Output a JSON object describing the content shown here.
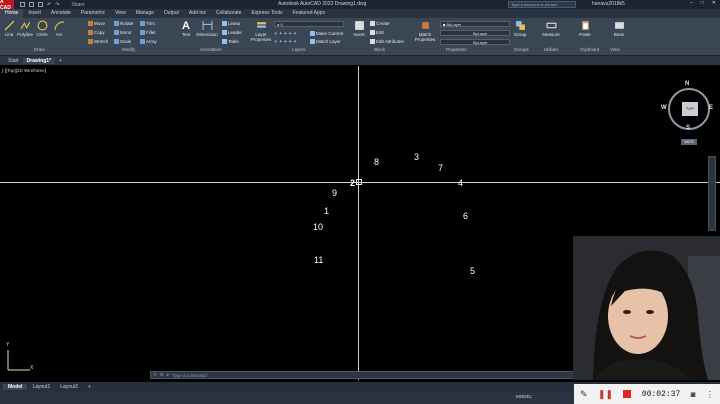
{
  "title_bar": {
    "logo": "A CAD",
    "share": "Share",
    "app_title": "Autodesk AutoCAD 2023   Drawing1.dwg",
    "search_placeholder": "Type a keyword or phrase",
    "user": "honavu2018k5"
  },
  "ribbon_tabs": [
    "Home",
    "Insert",
    "Annotate",
    "Parametric",
    "View",
    "Manage",
    "Output",
    "Add-ins",
    "Collaborate",
    "Express Tools",
    "Featured Apps"
  ],
  "draw": {
    "line": "Line",
    "polyline": "Polyline",
    "circle": "Circle",
    "arc": "Arc",
    "label": "Draw"
  },
  "modify": {
    "move": "Move",
    "rotate": "Rotate",
    "trim": "Trim",
    "copy": "Copy",
    "mirror": "Mirror",
    "fillet": "Fillet",
    "stretch": "Stretch",
    "scale": "Scale",
    "array": "Array",
    "label": "Modify"
  },
  "annotation": {
    "text": "Text",
    "dimension": "Dimension",
    "linear": "Linear",
    "leader": "Leader",
    "table": "Table",
    "label": "Annotation"
  },
  "layers": {
    "layer_properties": "Layer Properties",
    "current_layer": "0",
    "make_current": "Make Current",
    "match_layer": "Match Layer",
    "label": "Layers"
  },
  "block": {
    "insert": "Insert",
    "create": "Create",
    "edit": "Edit",
    "edit_attributes": "Edit Attributes",
    "label": "Block"
  },
  "properties": {
    "match": "Match Properties",
    "bylayer1": "ByLayer",
    "bylayer2": "ByLayer",
    "bylayer3": "ByLayer",
    "label": "Properties"
  },
  "groups": {
    "group": "Group",
    "label": "Groups"
  },
  "utilities": {
    "measure": "Measure",
    "label": "Utilities"
  },
  "clipboard": {
    "paste": "Paste",
    "label": "Clipboard"
  },
  "view": {
    "base": "Base",
    "label": "View"
  },
  "doc_tabs": [
    "Start",
    "Drawing1*"
  ],
  "viewport_label": "[-][Top][2D Wireframe]",
  "numbers": [
    "1",
    "2",
    "3",
    "4",
    "5",
    "6",
    "7",
    "8",
    "9",
    "10",
    "11"
  ],
  "viewcube": {
    "top": "TOP",
    "n": "N",
    "s": "S",
    "e": "E",
    "w": "W",
    "wcs": "WCS"
  },
  "ucs": {
    "x": "X",
    "y": "Y"
  },
  "command_placeholder": "Type a command",
  "layout_tabs": [
    "Model",
    "Layout1",
    "Layout2"
  ],
  "status": {
    "model": "MODEL"
  },
  "recorder": {
    "time": "00:02:37"
  }
}
